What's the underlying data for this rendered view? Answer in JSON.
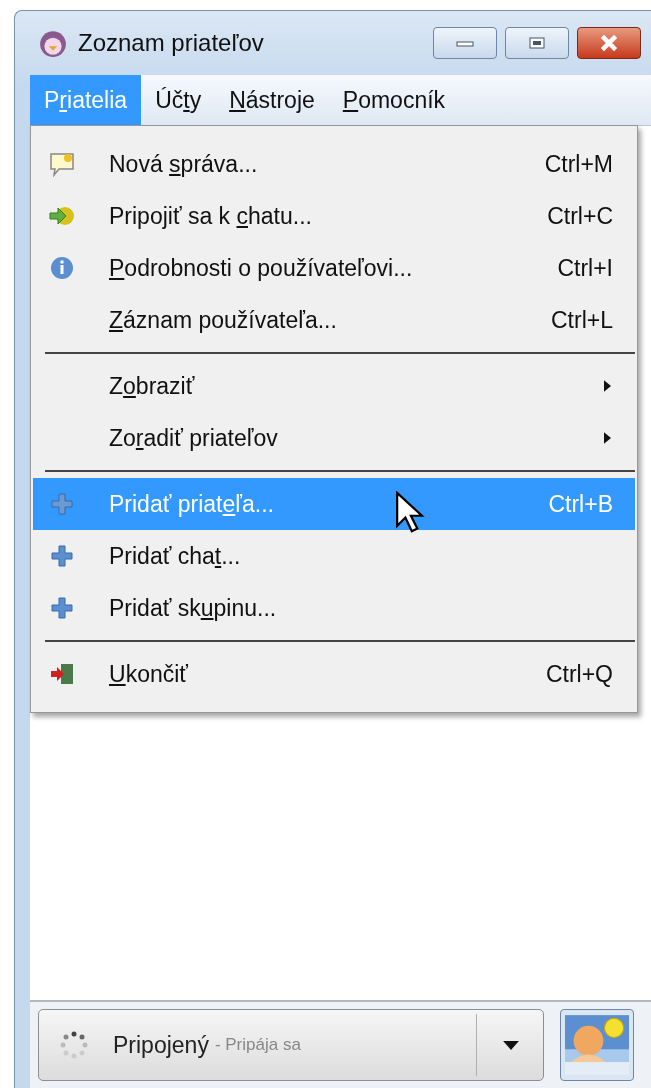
{
  "window": {
    "title": "Zoznam priateľov"
  },
  "menubar": [
    {
      "label": {
        "pre": "P",
        "key": "r",
        "post": "iatelia"
      },
      "selected": true
    },
    {
      "label": {
        "pre": "Úč",
        "key": "t",
        "post": "y"
      },
      "selected": false
    },
    {
      "label": {
        "key": "N",
        "post": "ástroje"
      },
      "selected": false
    },
    {
      "label": {
        "key": "P",
        "post": "omocník"
      },
      "selected": false
    }
  ],
  "menu": {
    "items": [
      {
        "kind": "item",
        "label": {
          "pre": "Nová ",
          "key": "s",
          "post": "práva..."
        },
        "shortcut": "Ctrl+M",
        "selected": false
      },
      {
        "kind": "item",
        "label": {
          "pre": "Pripojiť sa k ",
          "key": "c",
          "post": "hatu..."
        },
        "shortcut": "Ctrl+C",
        "selected": false
      },
      {
        "kind": "item",
        "label": {
          "key": "P",
          "post": "odrobnosti o používateľovi..."
        },
        "shortcut": "Ctrl+I",
        "selected": false
      },
      {
        "kind": "item",
        "label": {
          "key": "Z",
          "post": "áznam používateľa..."
        },
        "shortcut": "Ctrl+L",
        "selected": false
      },
      {
        "kind": "separator"
      },
      {
        "kind": "submenu",
        "label": {
          "pre": "Z",
          "key": "o",
          "post": "braziť"
        },
        "selected": false
      },
      {
        "kind": "submenu",
        "label": {
          "pre": "Zo",
          "key": "r",
          "post": "adiť priateľov"
        },
        "selected": false
      },
      {
        "kind": "separator"
      },
      {
        "kind": "item",
        "label": {
          "pre": "Pridať priat",
          "key": "e",
          "post": "ľa..."
        },
        "shortcut": "Ctrl+B",
        "selected": true
      },
      {
        "kind": "item",
        "label": {
          "pre": "Pridať cha",
          "key": "t",
          "post": "..."
        },
        "selected": false
      },
      {
        "kind": "item",
        "label": {
          "pre": "Pridať sk",
          "key": "u",
          "post": "pinu..."
        },
        "selected": false
      },
      {
        "kind": "separator"
      },
      {
        "kind": "item",
        "label": {
          "key": "U",
          "post": "končiť"
        },
        "shortcut": "Ctrl+Q",
        "selected": false
      }
    ]
  },
  "status": {
    "label": "Pripojený",
    "detail": "- Pripája sa"
  }
}
